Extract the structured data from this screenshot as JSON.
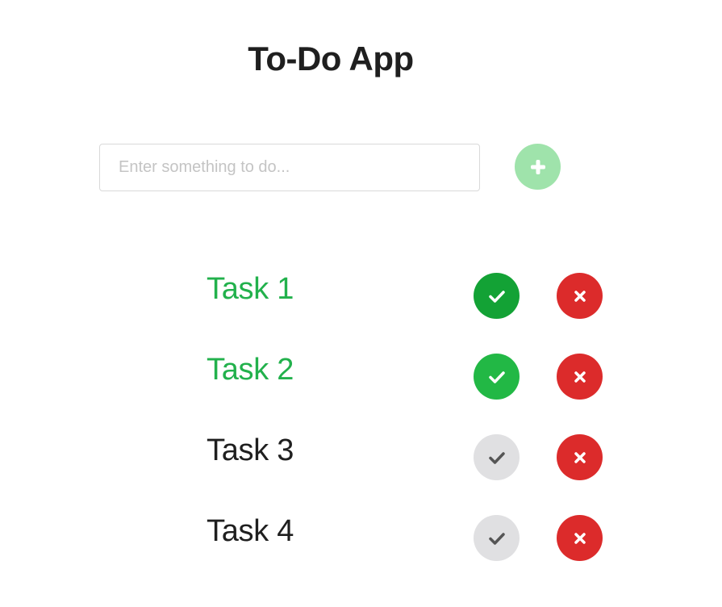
{
  "app": {
    "title": "To-Do App"
  },
  "input": {
    "placeholder": "Enter something to do...",
    "value": ""
  },
  "icons": {
    "add": "plus-icon",
    "complete": "check-icon",
    "delete": "close-icon"
  },
  "colors": {
    "done_text": "#22b14c",
    "done_check_active": "#13a235",
    "done_check": "#22b845",
    "open_check": "#e0e0e2",
    "delete": "#dc2b2b",
    "add_button": "#9fe3ab"
  },
  "tasks": [
    {
      "label": "Task 1",
      "completed": true
    },
    {
      "label": "Task 2",
      "completed": true
    },
    {
      "label": "Task 3",
      "completed": false
    },
    {
      "label": "Task 4",
      "completed": false
    }
  ]
}
